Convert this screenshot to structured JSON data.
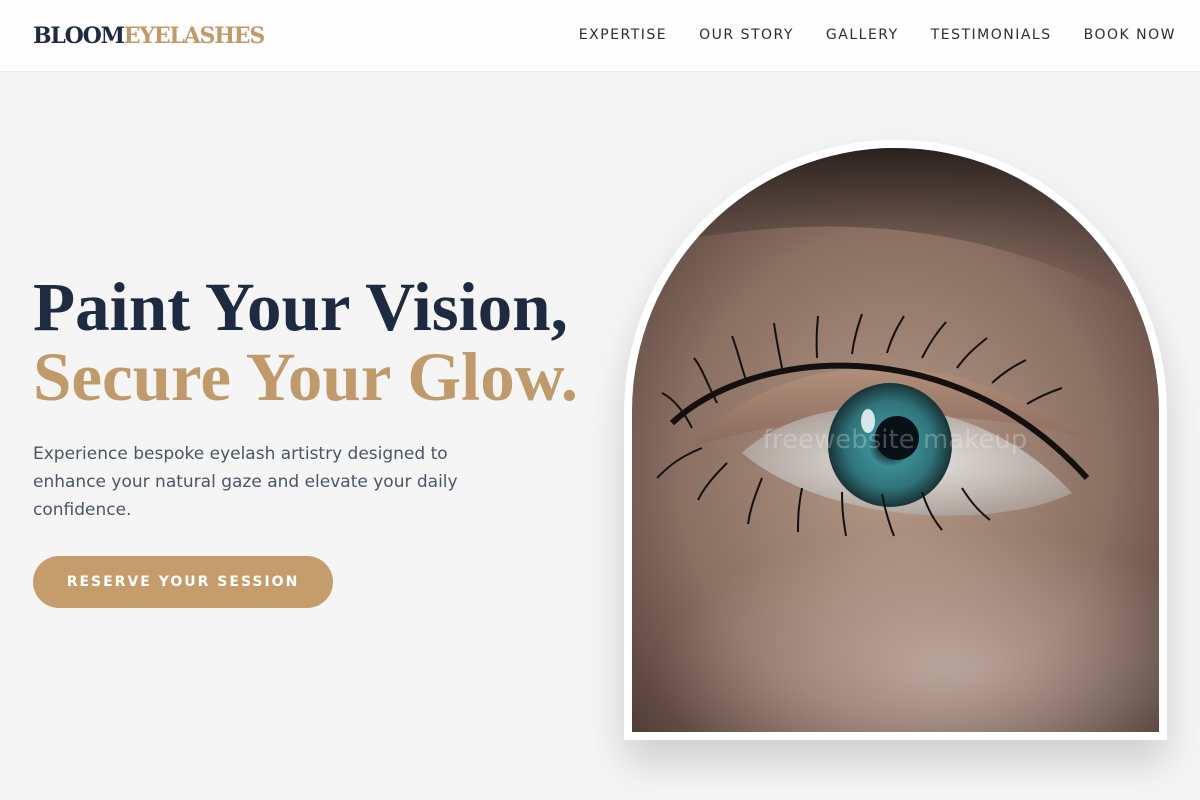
{
  "brand": {
    "part1": "BLOOM",
    "part2": "EYELASHES"
  },
  "nav": {
    "items": [
      {
        "label": "EXPERTISE"
      },
      {
        "label": "OUR STORY"
      },
      {
        "label": "GALLERY"
      },
      {
        "label": "TESTIMONIALS"
      },
      {
        "label": "BOOK NOW"
      }
    ]
  },
  "hero": {
    "title_line1": "Paint Your Vision,",
    "title_line2": "Secure Your Glow.",
    "description": "Experience bespoke eyelash artistry designed to enhance your natural gaze and elevate your daily confidence.",
    "cta_label": "RESERVE YOUR SESSION"
  },
  "image": {
    "watermark": "freewebsite makeup",
    "icon": "eye-closeup-photo"
  },
  "colors": {
    "navy": "#1e2a40",
    "gold": "#c09a6b",
    "button": "#c59d6c",
    "background": "#f5f5f5"
  }
}
